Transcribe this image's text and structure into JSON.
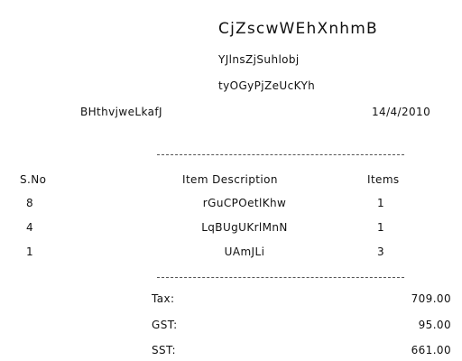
{
  "header": {
    "store_name": "CjZscwWEhXnhmB",
    "address_line_1": "YJlnsZjSuhlobj",
    "address_line_2": "tyOGyPjZeUcKYh",
    "cashier": "BHthvjweLkafJ",
    "date": "14/4/2010"
  },
  "table": {
    "columns": [
      "S.No",
      "Item Description",
      "Items"
    ],
    "rows": [
      {
        "sno": "8",
        "description": "rGuCPOetlKhw",
        "items": "1"
      },
      {
        "sno": "4",
        "description": "LqBUgUKrlMnN",
        "items": "1"
      },
      {
        "sno": "1",
        "description": "UAmJLi",
        "items": "3"
      }
    ]
  },
  "totals": [
    {
      "label": "Tax:",
      "value": "709.00"
    },
    {
      "label": "GST:",
      "value": "95.00"
    },
    {
      "label": "SST:",
      "value": "661.00"
    }
  ]
}
